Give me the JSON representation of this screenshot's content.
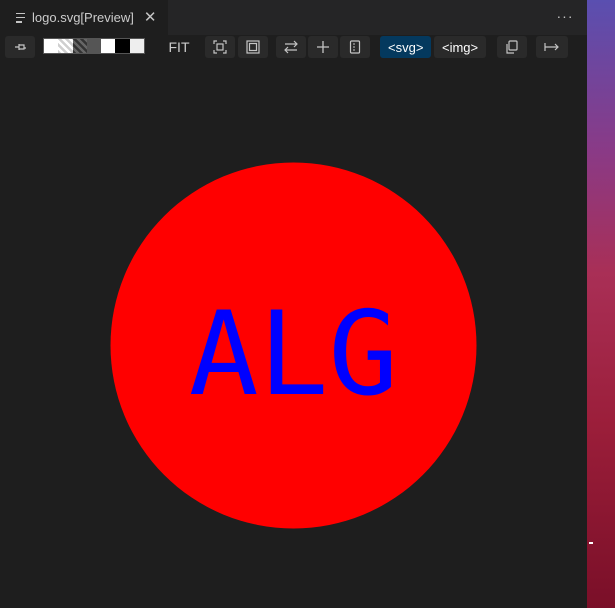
{
  "tab": {
    "title": "logo.svg[Preview]",
    "close_glyph": "✕"
  },
  "more_actions_glyph": "···",
  "toolbar": {
    "fit_label": "FIT",
    "svg_mode_label": "<svg>",
    "img_mode_label": "<img>",
    "background_swatches": [
      "#ffffff",
      "checker-light",
      "checker-dark",
      "#555555",
      "#ffffff",
      "#000000",
      "#eeeeee"
    ],
    "icons": [
      "pin-icon",
      "fit-content-icon",
      "fit-frame-icon",
      "swap-icon",
      "plus-icon",
      "panel-icon",
      "copy-icon",
      "export-icon"
    ],
    "active_mode_color": "#04395e"
  },
  "preview": {
    "circle_color": "#ff0000",
    "text": "ALG",
    "text_color": "#0000ff"
  },
  "colors": {
    "editor_bg": "#1e1e1e",
    "tabbar_bg": "#252526"
  }
}
